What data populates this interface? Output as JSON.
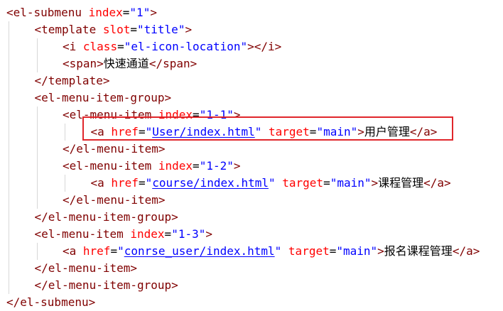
{
  "code_view": {
    "lines": [
      {
        "indent": 0,
        "tokens": [
          {
            "type": "tag",
            "text": "<el-submenu"
          },
          {
            "type": "txt",
            "text": " "
          },
          {
            "type": "attr",
            "text": "index"
          },
          {
            "type": "txt",
            "text": "="
          },
          {
            "type": "val",
            "text": "\"1\""
          },
          {
            "type": "tag",
            "text": ">"
          }
        ]
      },
      {
        "indent": 1,
        "tokens": [
          {
            "type": "tag",
            "text": "<template"
          },
          {
            "type": "txt",
            "text": " "
          },
          {
            "type": "attr",
            "text": "slot"
          },
          {
            "type": "txt",
            "text": "="
          },
          {
            "type": "val",
            "text": "\"title\""
          },
          {
            "type": "tag",
            "text": ">"
          }
        ]
      },
      {
        "indent": 2,
        "tokens": [
          {
            "type": "tag",
            "text": "<i"
          },
          {
            "type": "txt",
            "text": " "
          },
          {
            "type": "attr",
            "text": "class"
          },
          {
            "type": "txt",
            "text": "="
          },
          {
            "type": "val",
            "text": "\"el-icon-location\""
          },
          {
            "type": "tag",
            "text": "></i>"
          }
        ]
      },
      {
        "indent": 2,
        "tokens": [
          {
            "type": "tag",
            "text": "<span>"
          },
          {
            "type": "cjk",
            "text": "快速通道"
          },
          {
            "type": "tag",
            "text": "</span>"
          }
        ]
      },
      {
        "indent": 1,
        "tokens": [
          {
            "type": "tag",
            "text": "</template>"
          }
        ]
      },
      {
        "indent": 1,
        "tokens": [
          {
            "type": "tag",
            "text": "<el-menu-item-group>"
          }
        ]
      },
      {
        "indent": 2,
        "tokens": [
          {
            "type": "tag",
            "text": "<el-menu-item"
          },
          {
            "type": "txt",
            "text": " "
          },
          {
            "type": "attr",
            "text": "index"
          },
          {
            "type": "txt",
            "text": "="
          },
          {
            "type": "val",
            "text": "\"1-1\""
          },
          {
            "type": "tag",
            "text": ">"
          }
        ]
      },
      {
        "indent": 3,
        "tokens": [
          {
            "type": "tag",
            "text": "<a"
          },
          {
            "type": "txt",
            "text": " "
          },
          {
            "type": "attr",
            "text": "href"
          },
          {
            "type": "txt",
            "text": "="
          },
          {
            "type": "val",
            "text": "\""
          },
          {
            "type": "url",
            "text": "User/index.html"
          },
          {
            "type": "val",
            "text": "\""
          },
          {
            "type": "txt",
            "text": " "
          },
          {
            "type": "attr",
            "text": "target"
          },
          {
            "type": "txt",
            "text": "="
          },
          {
            "type": "val",
            "text": "\"main\""
          },
          {
            "type": "tag",
            "text": ">"
          },
          {
            "type": "cjk",
            "text": "用户管理"
          },
          {
            "type": "tag",
            "text": "</a>"
          }
        ]
      },
      {
        "indent": 2,
        "tokens": [
          {
            "type": "tag",
            "text": "</el-menu-item>"
          }
        ]
      },
      {
        "indent": 2,
        "tokens": [
          {
            "type": "tag",
            "text": "<el-menu-item"
          },
          {
            "type": "txt",
            "text": " "
          },
          {
            "type": "attr",
            "text": "index"
          },
          {
            "type": "txt",
            "text": "="
          },
          {
            "type": "val",
            "text": "\"1-2\""
          },
          {
            "type": "tag",
            "text": ">"
          }
        ]
      },
      {
        "indent": 3,
        "tokens": [
          {
            "type": "tag",
            "text": "<a"
          },
          {
            "type": "txt",
            "text": " "
          },
          {
            "type": "attr",
            "text": "href"
          },
          {
            "type": "txt",
            "text": "="
          },
          {
            "type": "val",
            "text": "\""
          },
          {
            "type": "url",
            "text": "course/index.html"
          },
          {
            "type": "val",
            "text": "\""
          },
          {
            "type": "txt",
            "text": " "
          },
          {
            "type": "attr",
            "text": "target"
          },
          {
            "type": "txt",
            "text": "="
          },
          {
            "type": "val",
            "text": "\"main\""
          },
          {
            "type": "tag",
            "text": ">"
          },
          {
            "type": "cjk",
            "text": "课程管理"
          },
          {
            "type": "tag",
            "text": "</a>"
          }
        ]
      },
      {
        "indent": 2,
        "tokens": [
          {
            "type": "tag",
            "text": "</el-menu-item>"
          }
        ]
      },
      {
        "indent": 1,
        "tokens": [
          {
            "type": "tag",
            "text": "</el-menu-item-group>"
          }
        ]
      },
      {
        "indent": 1,
        "tokens": [
          {
            "type": "tag",
            "text": "<el-menu-item"
          },
          {
            "type": "txt",
            "text": " "
          },
          {
            "type": "attr",
            "text": "index"
          },
          {
            "type": "txt",
            "text": "="
          },
          {
            "type": "val",
            "text": "\"1-3\""
          },
          {
            "type": "tag",
            "text": ">"
          }
        ]
      },
      {
        "indent": 2,
        "tokens": [
          {
            "type": "tag",
            "text": "<a"
          },
          {
            "type": "txt",
            "text": " "
          },
          {
            "type": "attr",
            "text": "href"
          },
          {
            "type": "txt",
            "text": "="
          },
          {
            "type": "val",
            "text": "\""
          },
          {
            "type": "url",
            "text": "conrse_user/index.html"
          },
          {
            "type": "val",
            "text": "\""
          },
          {
            "type": "txt",
            "text": " "
          },
          {
            "type": "attr",
            "text": "target"
          },
          {
            "type": "txt",
            "text": "="
          },
          {
            "type": "val",
            "text": "\"main\""
          },
          {
            "type": "tag",
            "text": ">"
          },
          {
            "type": "cjk",
            "text": "报名课程管理"
          },
          {
            "type": "tag",
            "text": "</a>"
          }
        ]
      },
      {
        "indent": 1,
        "tokens": [
          {
            "type": "tag",
            "text": "</el-menu-item>"
          }
        ]
      },
      {
        "indent": 1,
        "tokens": [
          {
            "type": "tag",
            "text": "</el-menu-item-group>"
          }
        ]
      },
      {
        "indent": 0,
        "tokens": [
          {
            "type": "tag",
            "text": "</el-submenu>"
          }
        ]
      }
    ]
  },
  "colors": {
    "tag": "#800000",
    "attribute": "#ff0000",
    "value": "#0000ff",
    "text": "#000000",
    "highlight_border": "#e0262b",
    "indent_guide": "#d7d7d7"
  }
}
